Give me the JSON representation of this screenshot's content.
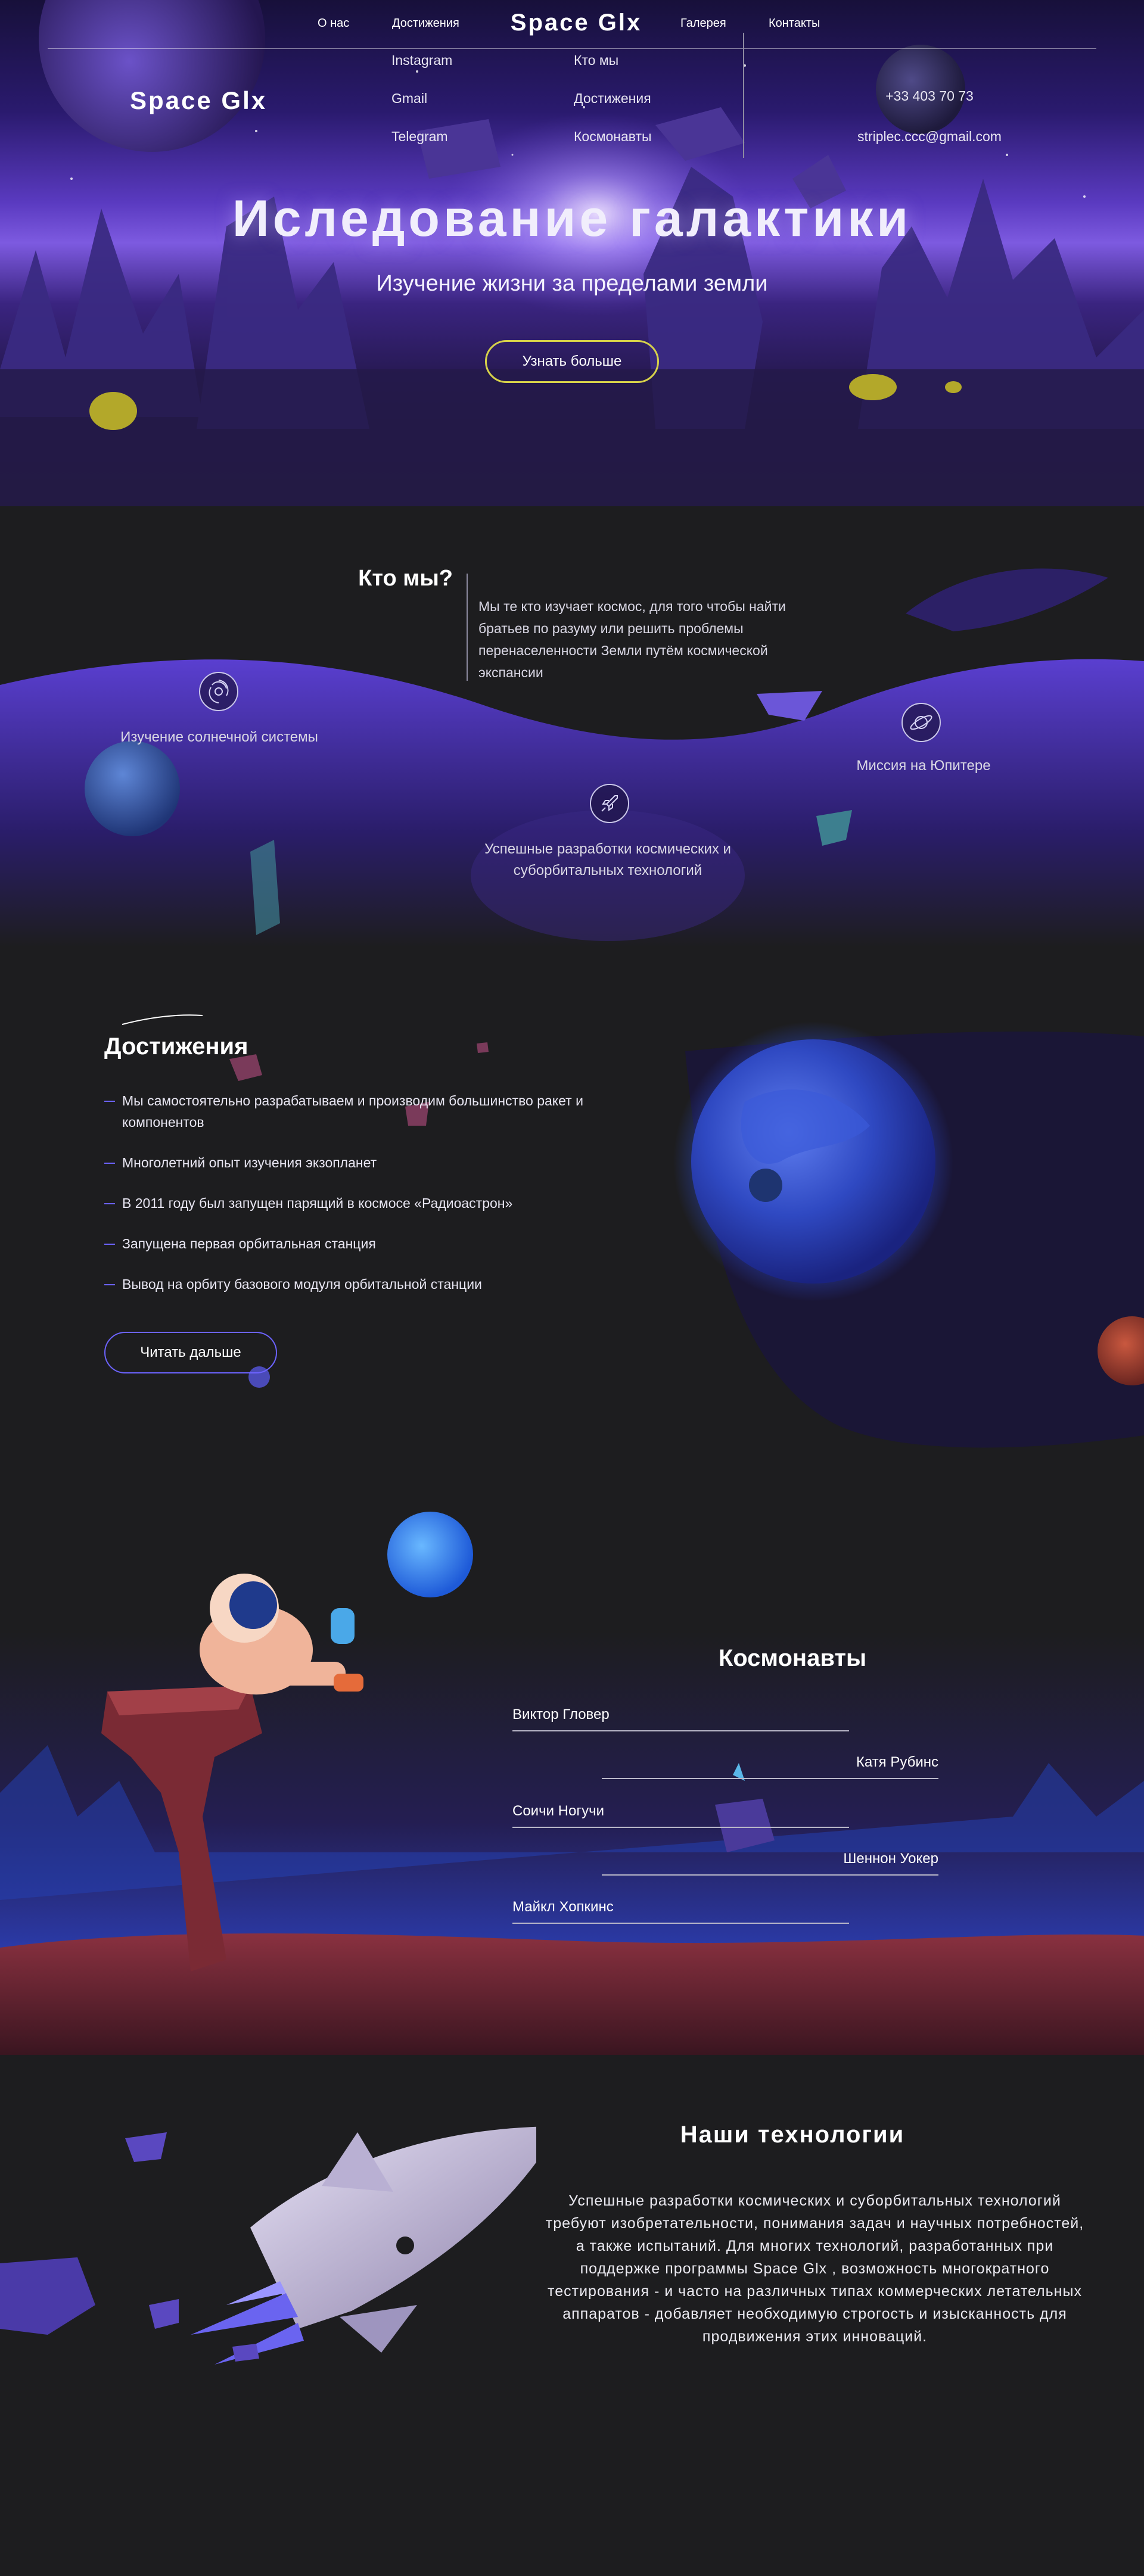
{
  "nav": {
    "items": [
      "О нас",
      "Достижения",
      "Галерея",
      "Контакты"
    ],
    "logo": "Space Glx"
  },
  "hero": {
    "title": "Иследование галактики",
    "subtitle": "Изучение жизни за пределами земли",
    "button": "Узнать больше"
  },
  "about": {
    "title": "Кто мы?",
    "text": "Мы те кто изучает космос, для того чтобы найти братьев по разуму или решить проблемы перенаселенности Земли путём космической экспансии",
    "features": [
      {
        "label": "Изучение солнечной системы",
        "icon": "galaxy-icon"
      },
      {
        "label": "Успешные разработки космических и суборбитальных технологий",
        "icon": "rocket-icon"
      },
      {
        "label": "Миссия на Юпитере",
        "icon": "planet-icon"
      }
    ]
  },
  "achievements": {
    "title": "Достижения",
    "items": [
      "Мы самостоятельно разрабатываем и производим большинство ракет и компонентов",
      "Многолетний опыт изучения экзопланет",
      "В 2011 году был запущен парящий в космосе «Радиоастрон»",
      "Запущена первая орбитальная станция",
      "Вывод на орбиту базового модуля орбитальной станции"
    ],
    "button": "Читать дальше"
  },
  "cosmonauts": {
    "title": "Космонавты",
    "names": [
      "Виктор Гловер",
      "Катя Рубинс",
      "Соичи Ногучи",
      "Шеннон Уокер",
      "Майкл Хопкинс"
    ]
  },
  "technologies": {
    "title": "Наши технологии",
    "text": "Успешные разработки космических и суборбитальных технологий требуют изобретательности, понимания задач и научных потребностей, а также испытаний. Для многих технологий, разработанных при поддержке программы  Space Glx , возможность многократного тестирования - и часто на различных типах коммерческих летательных аппаратов - добавляет необходимую строгость и изысканность для продвижения этих инноваций."
  },
  "footer": {
    "logo": "Space Glx",
    "social": [
      "Instagram",
      "Gmail",
      "Telegram"
    ],
    "links": [
      "Кто мы",
      "Достижения",
      "Космонавты"
    ],
    "phone": "+33 403 70 73",
    "email": "striplec.ccc@gmail.com"
  },
  "colors": {
    "background": "#1d1d1f",
    "accent": "#6c63ff",
    "hero_button_border": "#d7d24a"
  }
}
